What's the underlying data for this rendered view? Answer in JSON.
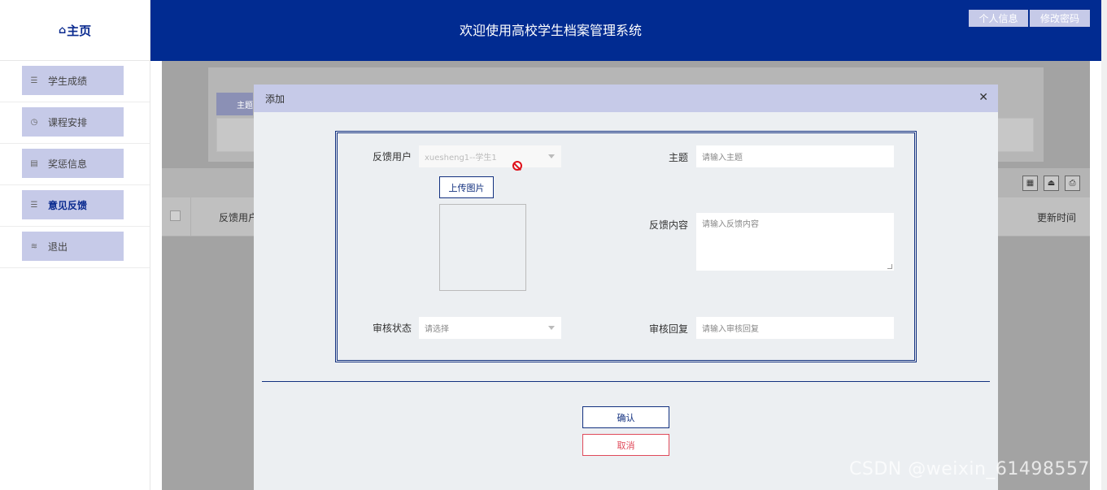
{
  "sidebar": {
    "brand": {
      "icon": "home-icon",
      "label": "主页"
    },
    "items": [
      {
        "label": "学生成绩",
        "icon": "list-icon",
        "active": false
      },
      {
        "label": "课程安排",
        "icon": "clock-icon",
        "active": false
      },
      {
        "label": "奖惩信息",
        "icon": "doc-icon",
        "active": false
      },
      {
        "label": "意见反馈",
        "icon": "list-icon",
        "active": true
      },
      {
        "label": "退出",
        "icon": "layers-icon",
        "active": false
      }
    ]
  },
  "header": {
    "title": "欢迎使用高校学生档案管理系统",
    "profile_label": "个人信息",
    "password_label": "修改密码"
  },
  "background": {
    "search_tab_label": "主题",
    "table_headers": {
      "user": "反馈用户",
      "time": "更新时间"
    },
    "toolbar_icons": [
      "grid-icon",
      "upload-icon",
      "print-icon"
    ]
  },
  "modal": {
    "title": "添加",
    "close_icon": "close-icon",
    "fields": {
      "user_label": "反馈用户",
      "user_value": "xuesheng1--学生1",
      "subject_label": "主题",
      "subject_placeholder": "请输入主题",
      "upload_label": "上传图片",
      "content_label": "反馈内容",
      "content_placeholder": "请输入反馈内容",
      "status_label": "审核状态",
      "status_placeholder": "请选择",
      "reply_label": "审核回复",
      "reply_placeholder": "请输入审核回复"
    },
    "confirm_label": "确认",
    "cancel_label": "取消"
  },
  "watermark": "CSDN @weixin_61498557",
  "colors": {
    "primary": "#012b91",
    "accent_light": "#c6cae8",
    "cancel": "#e04a5a",
    "ban": "#e0101a"
  }
}
